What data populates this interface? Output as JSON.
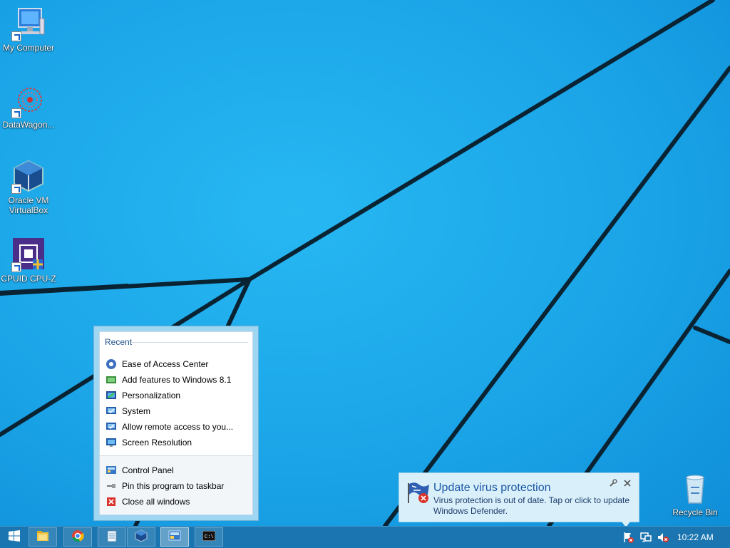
{
  "desktop": {
    "icons": [
      {
        "label": "My Computer",
        "icon": "computer-icon"
      },
      {
        "label": "DataWagon...",
        "icon": "datawagon-icon"
      },
      {
        "label": "Oracle VM VirtualBox",
        "icon": "virtualbox-icon"
      },
      {
        "label": "CPUID CPU-Z",
        "icon": "cpuz-icon"
      },
      {
        "label": "Recycle Bin",
        "icon": "recycle-bin-icon"
      }
    ]
  },
  "jumplist": {
    "recent_label": "Recent",
    "recent_items": [
      {
        "label": "Ease of Access Center",
        "icon": "ease-of-access-icon"
      },
      {
        "label": "Add features to Windows 8.1",
        "icon": "add-features-icon"
      },
      {
        "label": "Personalization",
        "icon": "personalization-icon"
      },
      {
        "label": "System",
        "icon": "system-icon"
      },
      {
        "label": "Allow remote access to you...",
        "icon": "remote-access-icon"
      },
      {
        "label": "Screen Resolution",
        "icon": "screen-resolution-icon"
      }
    ],
    "tasks": [
      {
        "label": "Control Panel",
        "icon": "control-panel-icon"
      },
      {
        "label": "Pin this program to taskbar",
        "icon": "pin-icon"
      },
      {
        "label": "Close all windows",
        "icon": "close-red-icon"
      }
    ]
  },
  "notification": {
    "title": "Update virus protection",
    "message": "Virus protection is out of date. Tap or click to update Windows Defender.",
    "icon": "defender-flag-icon"
  },
  "taskbar": {
    "buttons": [
      "start-icon",
      "file-explorer-icon",
      "chrome-icon",
      "notepad-icon",
      "virtualbox-icon",
      "control-panel-icon",
      "cmd-icon"
    ],
    "tray_icons": [
      "action-center-warning-icon",
      "network-icon",
      "volume-muted-icon"
    ],
    "clock": "10:22 AM"
  },
  "colors": {
    "desktop": "#1ba5e8",
    "taskbar": "#1a75b0",
    "accent": "#1a56a3"
  }
}
